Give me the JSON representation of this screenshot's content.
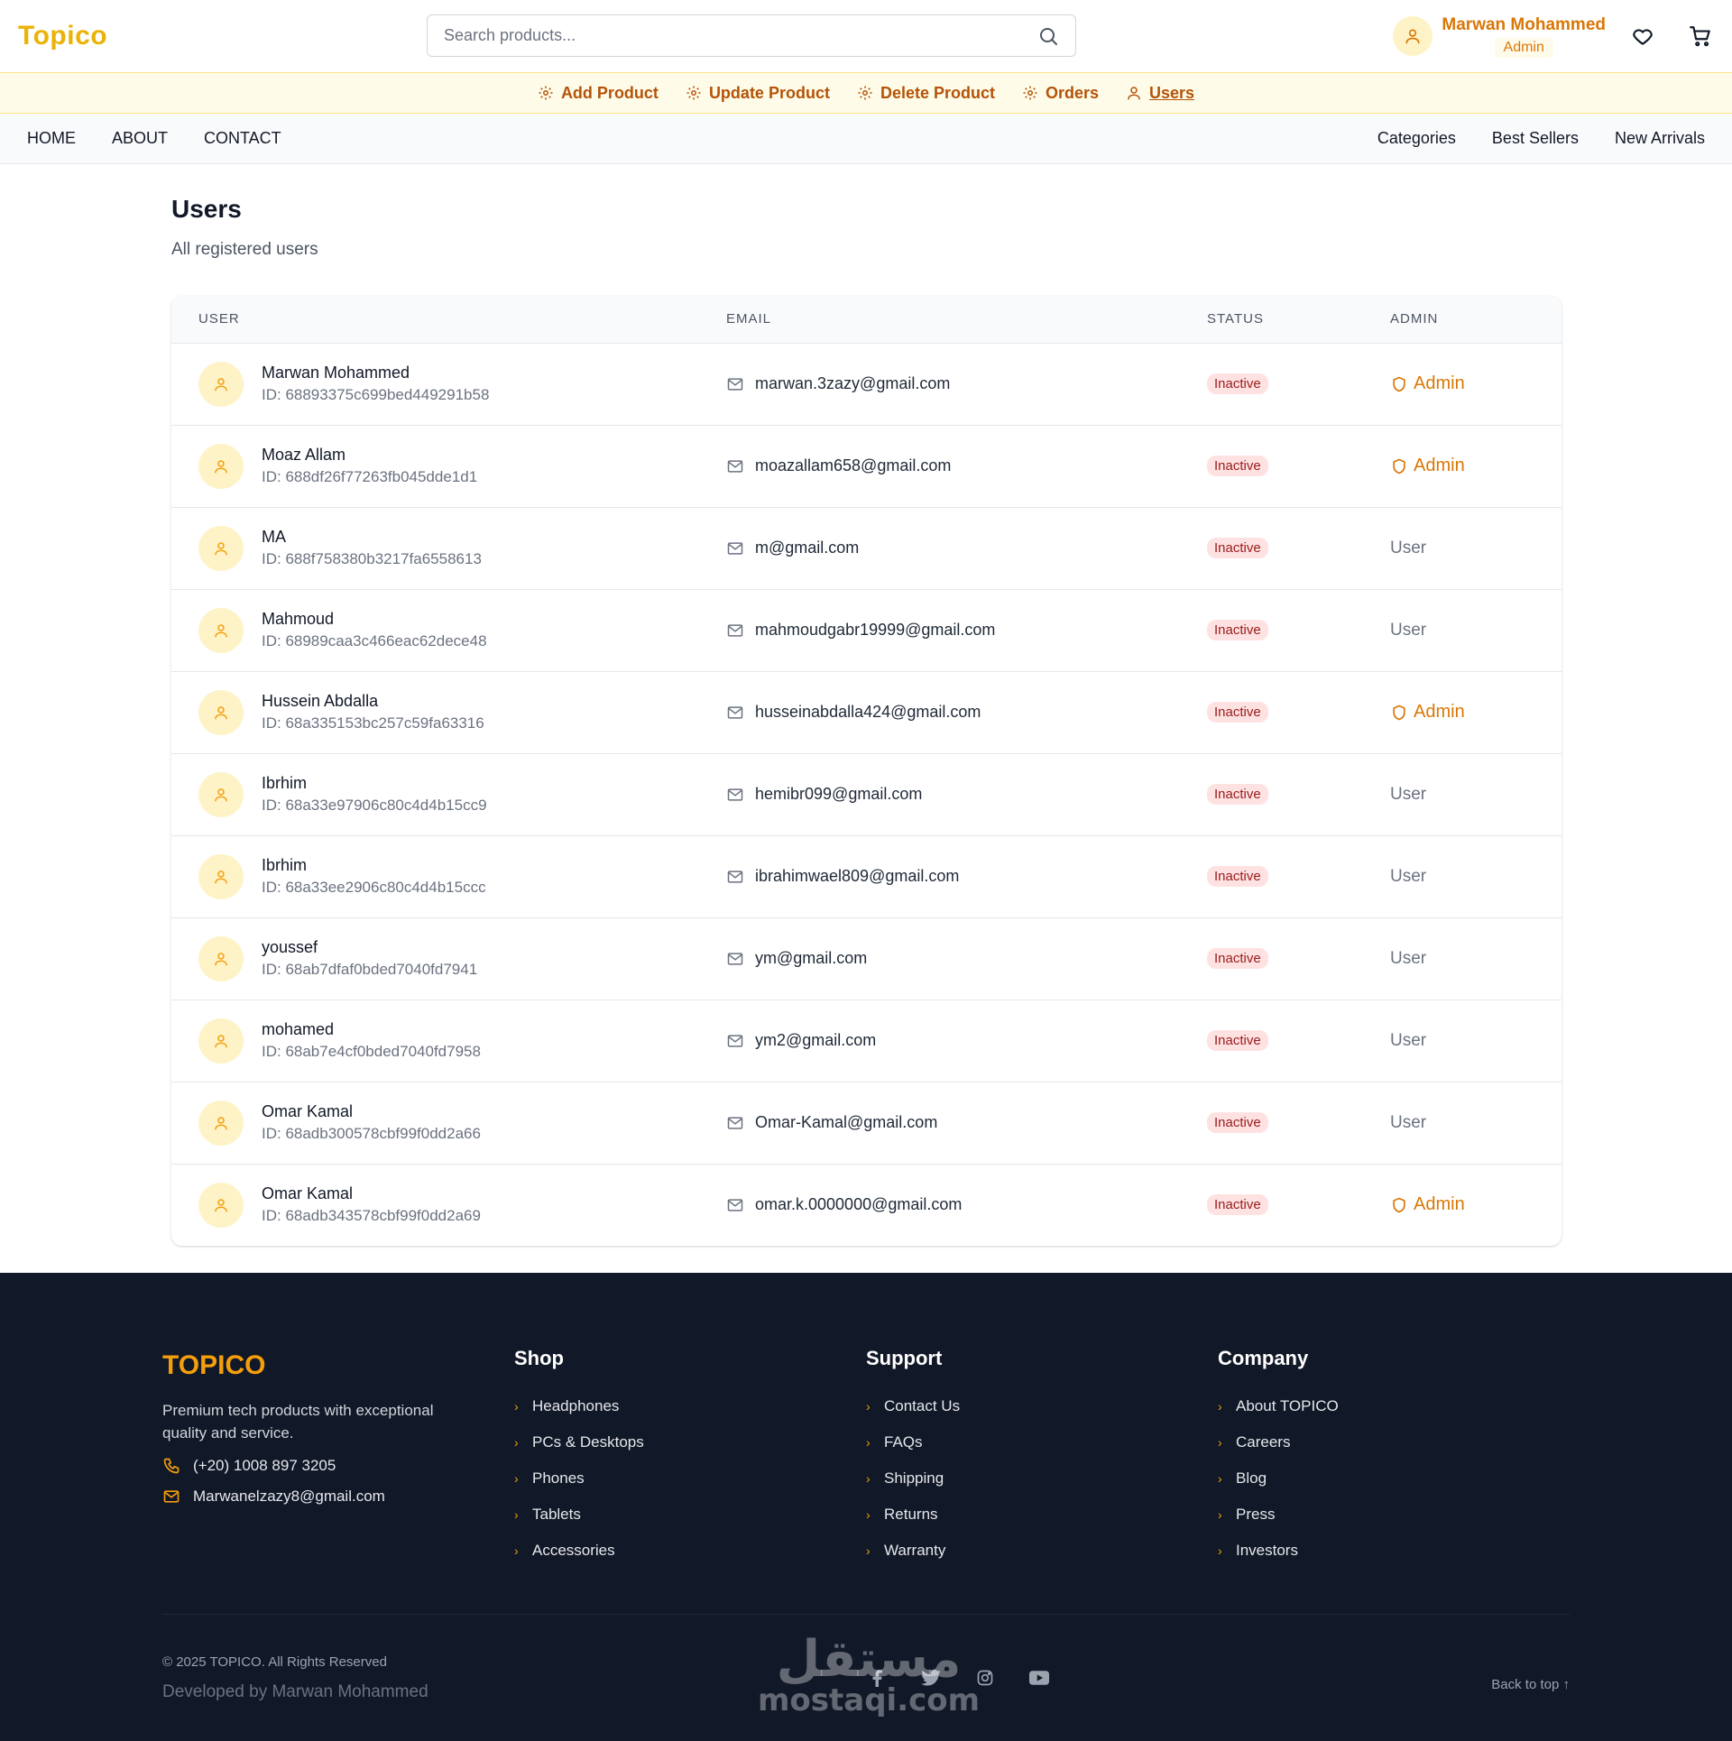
{
  "header": {
    "logo": "Topico",
    "search_placeholder": "Search products...",
    "user_name": "Marwan Mohammed",
    "user_role": "Admin",
    "icons": [
      "search-icon",
      "user-icon",
      "heart-icon",
      "cart-icon"
    ]
  },
  "adminbar": {
    "items": [
      {
        "label": "Add Product",
        "icon": "gear-icon"
      },
      {
        "label": "Update Product",
        "icon": "gear-icon"
      },
      {
        "label": "Delete Product",
        "icon": "gear-icon"
      },
      {
        "label": "Orders",
        "icon": "gear-icon"
      },
      {
        "label": "Users",
        "icon": "user-icon",
        "active": true
      }
    ]
  },
  "nav": {
    "left": [
      "HOME",
      "ABOUT",
      "CONTACT"
    ],
    "right": [
      "Categories",
      "Best Sellers",
      "New Arrivals"
    ]
  },
  "page": {
    "title": "Users",
    "subtitle": "All registered users"
  },
  "table": {
    "headers": [
      "USER",
      "EMAIL",
      "STATUS",
      "ADMIN"
    ],
    "rows": [
      {
        "name": "Marwan Mohammed",
        "id": "ID: 68893375c699bed449291b58",
        "email": "marwan.3zazy@gmail.com",
        "status": "Inactive",
        "role": "Admin"
      },
      {
        "name": "Moaz Allam",
        "id": "ID: 688df26f77263fb045dde1d1",
        "email": "moazallam658@gmail.com",
        "status": "Inactive",
        "role": "Admin"
      },
      {
        "name": "MA",
        "id": "ID: 688f758380b3217fa6558613",
        "email": "m@gmail.com",
        "status": "Inactive",
        "role": "User"
      },
      {
        "name": "Mahmoud",
        "id": "ID: 68989caa3c466eac62dece48",
        "email": "mahmoudgabr19999@gmail.com",
        "status": "Inactive",
        "role": "User"
      },
      {
        "name": "Hussein Abdalla",
        "id": "ID: 68a335153bc257c59fa63316",
        "email": "husseinabdalla424@gmail.com",
        "status": "Inactive",
        "role": "Admin"
      },
      {
        "name": "Ibrhim",
        "id": "ID: 68a33e97906c80c4d4b15cc9",
        "email": "hemibr099@gmail.com",
        "status": "Inactive",
        "role": "User"
      },
      {
        "name": "Ibrhim",
        "id": "ID: 68a33ee2906c80c4d4b15ccc",
        "email": "ibrahimwael809@gmail.com",
        "status": "Inactive",
        "role": "User"
      },
      {
        "name": "youssef",
        "id": "ID: 68ab7dfaf0bded7040fd7941",
        "email": "ym@gmail.com",
        "status": "Inactive",
        "role": "User"
      },
      {
        "name": "mohamed",
        "id": "ID: 68ab7e4cf0bded7040fd7958",
        "email": "ym2@gmail.com",
        "status": "Inactive",
        "role": "User"
      },
      {
        "name": "Omar Kamal",
        "id": "ID: 68adb300578cbf99f0dd2a66",
        "email": "Omar-Kamal@gmail.com",
        "status": "Inactive",
        "role": "User"
      },
      {
        "name": "Omar Kamal",
        "id": "ID: 68adb343578cbf99f0dd2a69",
        "email": "omar.k.0000000@gmail.com",
        "status": "Inactive",
        "role": "Admin"
      }
    ]
  },
  "footer": {
    "logo": "TOPICO",
    "description": "Premium tech products with exceptional quality and service.",
    "phone": "(+20) 1008 897 3205",
    "email": "Marwanelzazy8@gmail.com",
    "columns": [
      {
        "title": "Shop",
        "links": [
          "Headphones",
          "PCs & Desktops",
          "Phones",
          "Tablets",
          "Accessories"
        ]
      },
      {
        "title": "Support",
        "links": [
          "Contact Us",
          "FAQs",
          "Shipping",
          "Returns",
          "Warranty"
        ]
      },
      {
        "title": "Company",
        "links": [
          "About TOPICO",
          "Careers",
          "Blog",
          "Press",
          "Investors"
        ]
      }
    ],
    "copyright": "© 2025 TOPICO. All Rights Reserved",
    "developer": "Developed by Marwan Mohammed",
    "back_to_top": "Back to top ↑",
    "socials": [
      "facebook-icon",
      "twitter-icon",
      "instagram-icon",
      "youtube-icon"
    ],
    "watermark_ar": "مستقل",
    "watermark_lat": "mostaqi.com"
  },
  "colors": {
    "brand": "#eab308",
    "accent": "#d97706",
    "inactive_bg": "#fee2e2",
    "inactive_text": "#991b1b",
    "footer_bg": "#111827"
  }
}
